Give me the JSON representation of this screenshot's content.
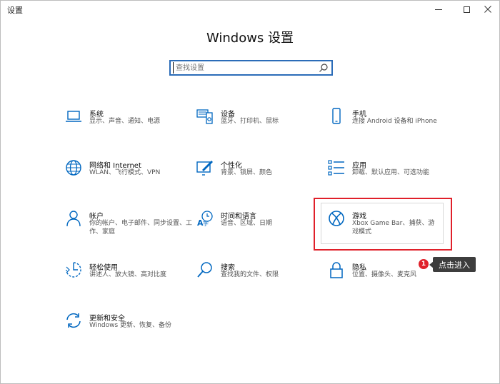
{
  "window": {
    "title": "设置",
    "page_title": "Windows 设置"
  },
  "search": {
    "placeholder": "查找设置"
  },
  "tiles": [
    {
      "title": "系统",
      "subtitle": "显示、声音、通知、电源",
      "icon": "laptop-icon"
    },
    {
      "title": "设备",
      "subtitle": "蓝牙、打印机、鼠标",
      "icon": "devices-icon"
    },
    {
      "title": "手机",
      "subtitle": "连接 Android 设备和 iPhone",
      "icon": "phone-icon"
    },
    {
      "title": "网络和 Internet",
      "subtitle": "WLAN、飞行模式、VPN",
      "icon": "globe-icon"
    },
    {
      "title": "个性化",
      "subtitle": "背景、锁屏、颜色",
      "icon": "paint-icon"
    },
    {
      "title": "应用",
      "subtitle": "卸载、默认应用、可选功能",
      "icon": "apps-list-icon"
    },
    {
      "title": "帐户",
      "subtitle": "你的帐户、电子邮件、同步设置、工作、家庭",
      "icon": "person-icon"
    },
    {
      "title": "时间和语言",
      "subtitle": "语音、区域、日期",
      "icon": "time-language-icon"
    },
    {
      "title": "游戏",
      "subtitle": "Xbox Game Bar、捕获、游戏模式",
      "icon": "xbox-icon"
    },
    {
      "title": "轻松使用",
      "subtitle": "讲述人、放大镜、高对比度",
      "icon": "ease-of-access-icon"
    },
    {
      "title": "搜索",
      "subtitle": "查找我的文件、权限",
      "icon": "magnifier-icon"
    },
    {
      "title": "隐私",
      "subtitle": "位置、摄像头、麦克风",
      "icon": "lock-icon"
    },
    {
      "title": "更新和安全",
      "subtitle": "Windows 更新、恢复、备份",
      "icon": "sync-icon"
    }
  ],
  "annotation": {
    "badge": "1",
    "callout": "点击进入",
    "highlight_color": "#e0202a"
  },
  "colors": {
    "icon_blue": "#0067c0",
    "search_border": "#2b6cb8"
  }
}
